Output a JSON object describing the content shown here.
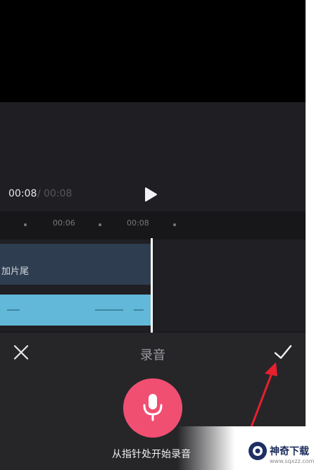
{
  "preview": {
    "current_time": "00:08",
    "separator": "/",
    "total_time": "00:08"
  },
  "ruler": {
    "labels": [
      "00:06",
      "00:08"
    ]
  },
  "tracks": {
    "video_label": "加片尾"
  },
  "record_panel": {
    "title": "录音",
    "hint": "从指针处开始录音"
  },
  "watermark": {
    "name": "神奇下载",
    "url": "www.sqxzz.com"
  },
  "icons": [
    "play-icon",
    "close-icon",
    "checkmark-icon",
    "microphone-icon",
    "red-arrow-annotation",
    "watermark-logo-icon"
  ],
  "colors": {
    "record_button": "#f04f72",
    "audio_track": "#62b8d8",
    "video_track": "#2e3e50",
    "annotation_arrow": "#e8202e"
  }
}
